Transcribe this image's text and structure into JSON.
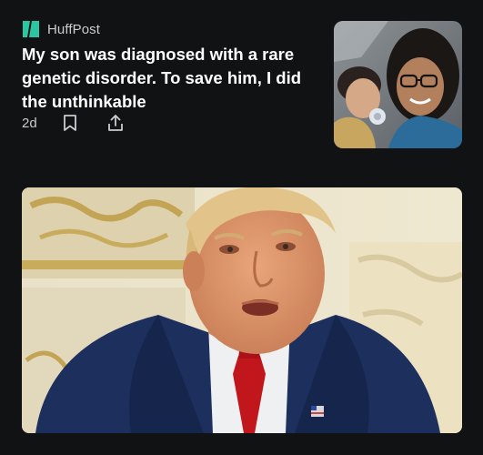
{
  "article": {
    "source": "HuffPost",
    "headline": "My son was diagnosed with a rare genetic disorder. To save him, I did the unthinkable",
    "age": "2d",
    "icons": {
      "logo": "huffpost-logo-icon",
      "bookmark": "bookmark-icon",
      "share": "share-icon"
    }
  },
  "colors": {
    "background": "#101214",
    "brand": "#2bc7a3",
    "text_primary": "#ffffff",
    "text_secondary": "#c9ccd0"
  }
}
